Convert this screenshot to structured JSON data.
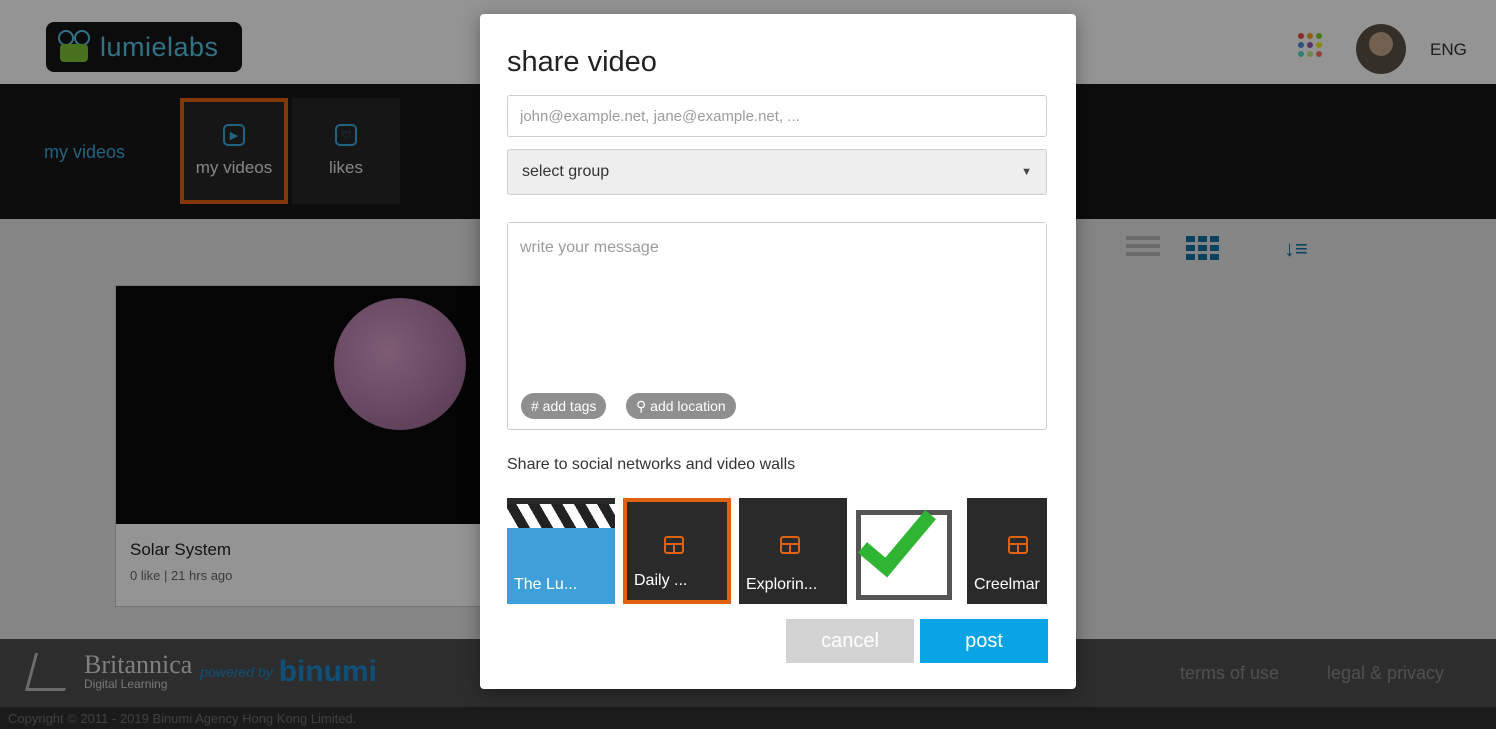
{
  "header": {
    "logo_text": "lumielabs",
    "language": "ENG",
    "apps_colors": [
      "#e94b3c",
      "#f5a623",
      "#7ed321",
      "#4a90e2",
      "#9b59b6",
      "#f8e71c",
      "#50e3c2",
      "#b8e986",
      "#ff6f61"
    ]
  },
  "subnav": {
    "title": "my videos",
    "tabs": [
      {
        "label": "my videos",
        "icon": "play-icon",
        "active": true
      },
      {
        "label": "likes",
        "icon": "heart-icon",
        "active": false
      }
    ]
  },
  "video": {
    "title": "Solar System",
    "meta": "0 like | 21 hrs ago"
  },
  "footer": {
    "brand_name": "Britannica",
    "brand_sub": "Digital Learning",
    "powered_by": "powered by",
    "binumi": "binumi",
    "terms": "terms of use",
    "legal": "legal & privacy",
    "copyright": "Copyright © 2011 - 2019 Binumi Agency Hong Kong Limited."
  },
  "modal": {
    "title": "share video",
    "email_placeholder": "john@example.net, jane@example.net, ...",
    "group_select": "select group",
    "message_placeholder": "write your message",
    "add_tags": "# add tags",
    "add_location": "add location",
    "share_label": "Share to social networks and video walls",
    "tiles": [
      "The Lu...",
      "Daily ...",
      "Explorin...",
      "",
      "Creelmar"
    ],
    "cancel": "cancel",
    "post": "post"
  },
  "colors": {
    "accent_orange": "#e0610f",
    "accent_blue": "#0aa3e3"
  }
}
